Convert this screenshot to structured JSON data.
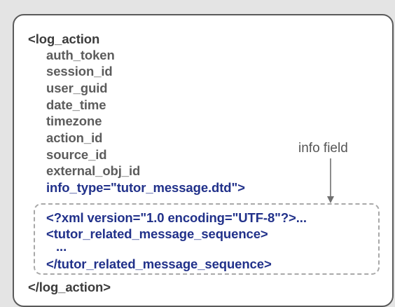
{
  "lines": [
    "<log_action",
    "auth_token",
    "session_id",
    "user_guid",
    "date_time",
    "timezone",
    "action_id",
    "source_id",
    "external_obj_id",
    "info_type=\"tutor_message.dtd\">"
  ],
  "info_label": "info field",
  "info_lines": [
    "<?xml version=\"1.0 encoding=\"UTF-8\"?>...",
    "<tutor_related_message_sequence>",
    "...",
    "</tutor_related_message_sequence>"
  ],
  "closing_tag": "</log_action>",
  "colors": {
    "frame_border": "#5a5a5a",
    "element_text": "#5c5c5c",
    "info_text": "#21318a",
    "dashed_border": "#a8a8a8"
  }
}
